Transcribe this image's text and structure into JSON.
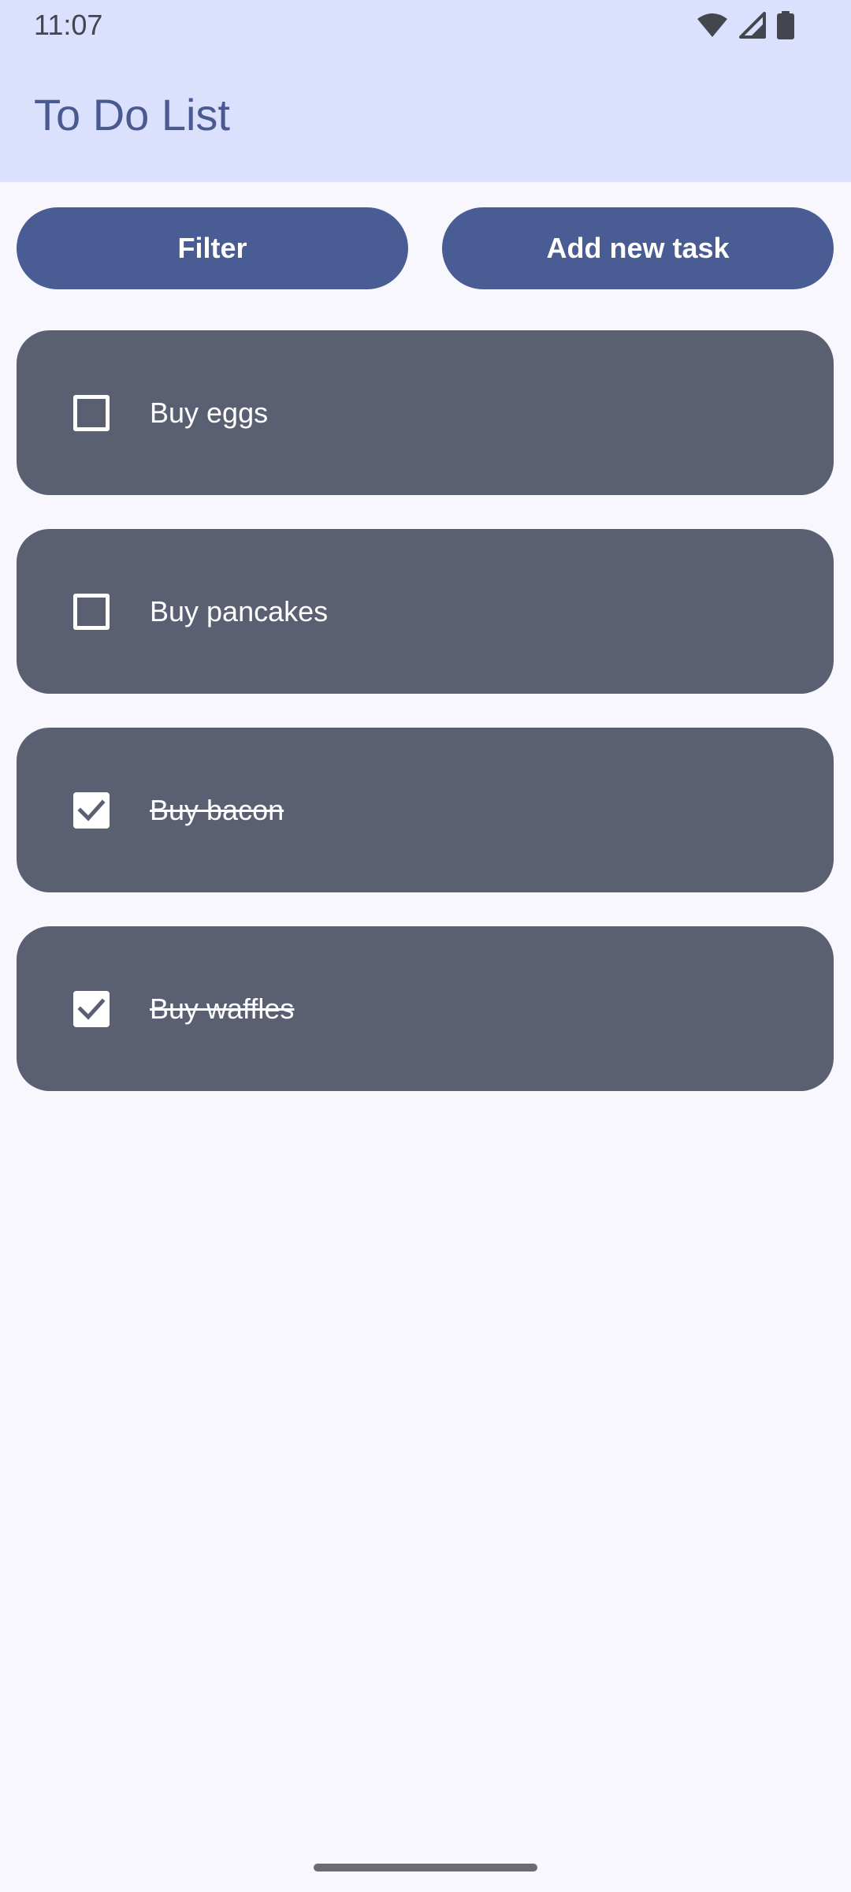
{
  "status_bar": {
    "time": "11:07",
    "icons": [
      "wifi-icon",
      "cellular-signal-icon",
      "battery-icon"
    ]
  },
  "app_bar": {
    "title": "To Do List"
  },
  "actions": {
    "filter_label": "Filter",
    "add_label": "Add new task"
  },
  "tasks": [
    {
      "label": "Buy eggs",
      "done": false
    },
    {
      "label": "Buy pancakes",
      "done": false
    },
    {
      "label": "Buy bacon",
      "done": true
    },
    {
      "label": "Buy waffles",
      "done": true
    }
  ],
  "colors": {
    "app_bar_bg": "#dbe0fd",
    "title_color": "#4a5a90",
    "button_bg": "#4a5c94",
    "card_bg": "#5b5f72",
    "page_bg": "#f8f7fd"
  }
}
